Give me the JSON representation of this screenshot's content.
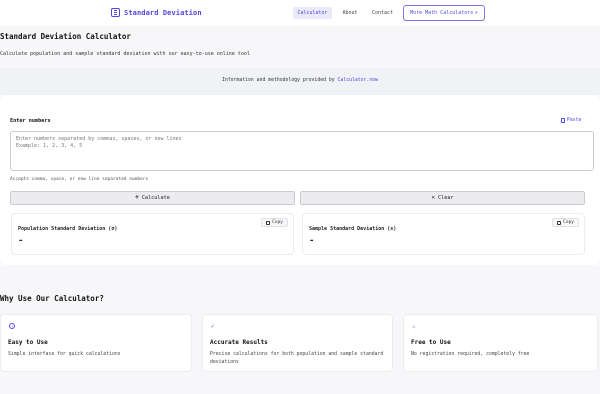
{
  "header": {
    "brand": "Standard Deviation",
    "nav": {
      "calculator": "Calculator",
      "about": "About",
      "contact": "Contact"
    },
    "more_button": "More Math Calculators"
  },
  "page": {
    "title": "Standard Deviation Calculator",
    "subtitle": "Calculate population and sample standard deviation with our easy-to-use online tool",
    "info_text": "Information and methodology provided by",
    "info_link": "Calculator.now"
  },
  "calculator": {
    "input_label": "Enter numbers",
    "paste_label": "Paste",
    "input_placeholder": "Enter numbers separated by commas, spaces, or new lines\nExample: 1, 2, 3, 4, 5",
    "input_value": "",
    "hint": "Accepts comma, space, or new line separated numbers",
    "calculate_label": "Calculate",
    "clear_label": "Clear"
  },
  "results": {
    "population": {
      "label": "Population Standard Deviation (σ)",
      "value": "-",
      "copy_label": "Copy"
    },
    "sample": {
      "label": "Sample Standard Deviation (s)",
      "value": "-",
      "copy_label": "Copy"
    }
  },
  "why": {
    "title": "Why Use Our Calculator?",
    "features": [
      {
        "icon": "target-icon",
        "title": "Easy to Use",
        "desc": "Simple interface for quick calculations"
      },
      {
        "icon": "check-icon",
        "title": "Accurate Results",
        "desc": "Precise calculations for both population and sample standard deviations"
      },
      {
        "icon": "star-icon",
        "title": "Free to Use",
        "desc": "No registration required, completely free"
      }
    ]
  },
  "colors": {
    "accent": "#4f46e5",
    "background": "#f7f7f9",
    "card": "#ffffff"
  }
}
